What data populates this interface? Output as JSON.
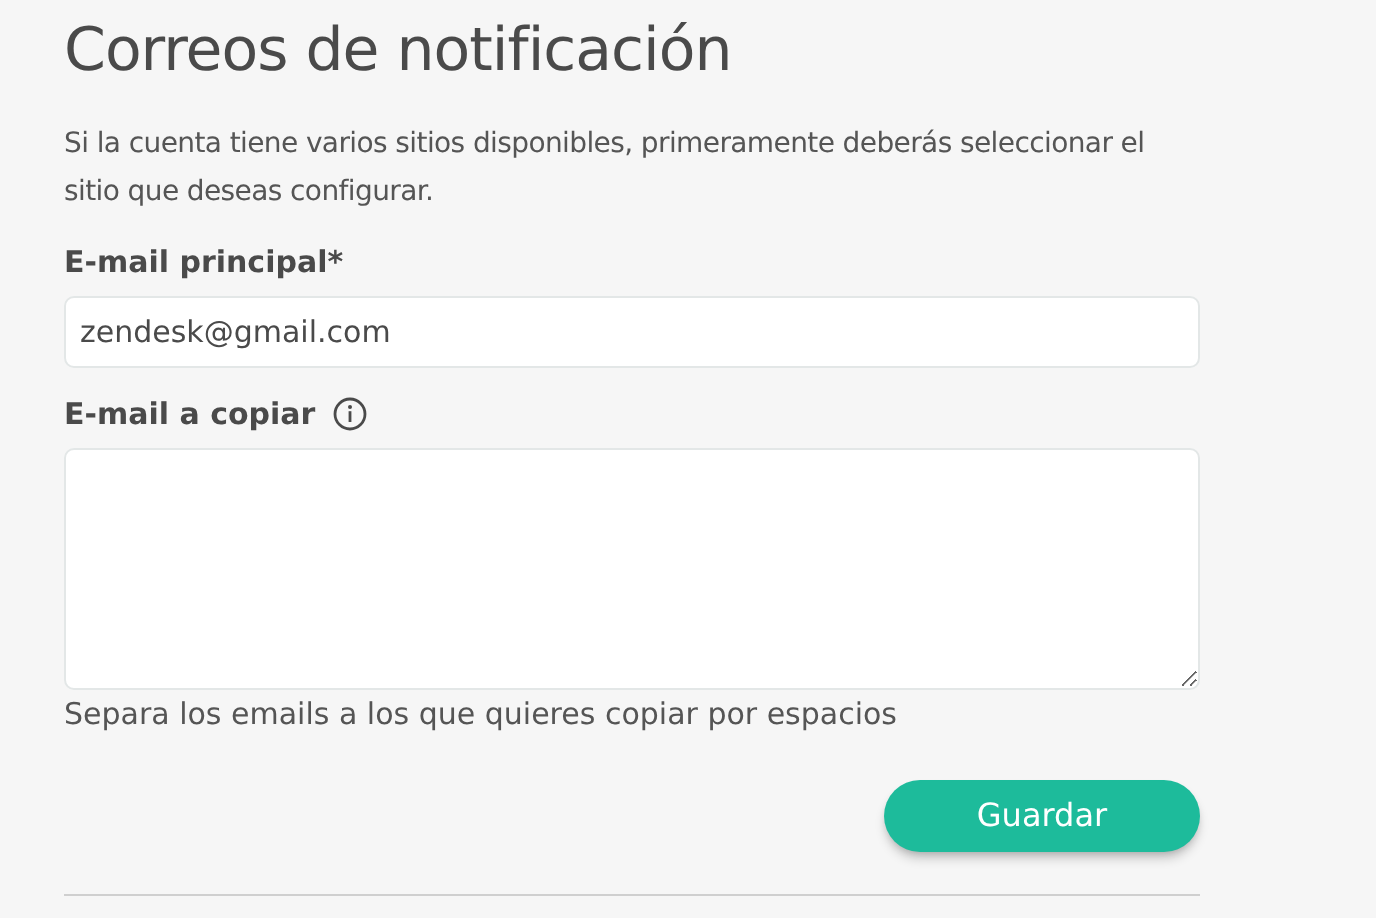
{
  "title": "Correos de notificación",
  "description": "Si la cuenta tiene varios sitios disponibles, primeramente deberás seleccionar el sitio que deseas configurar.",
  "fields": [
    {
      "kind": "input",
      "label": "E-mail principal*",
      "value": "zendesk@gmail.com",
      "info": false
    },
    {
      "kind": "textarea",
      "label": "E-mail a copiar",
      "info": true,
      "help": "Separa los emails a los que quieres copiar por espacios"
    }
  ],
  "save_button": "Guardar"
}
